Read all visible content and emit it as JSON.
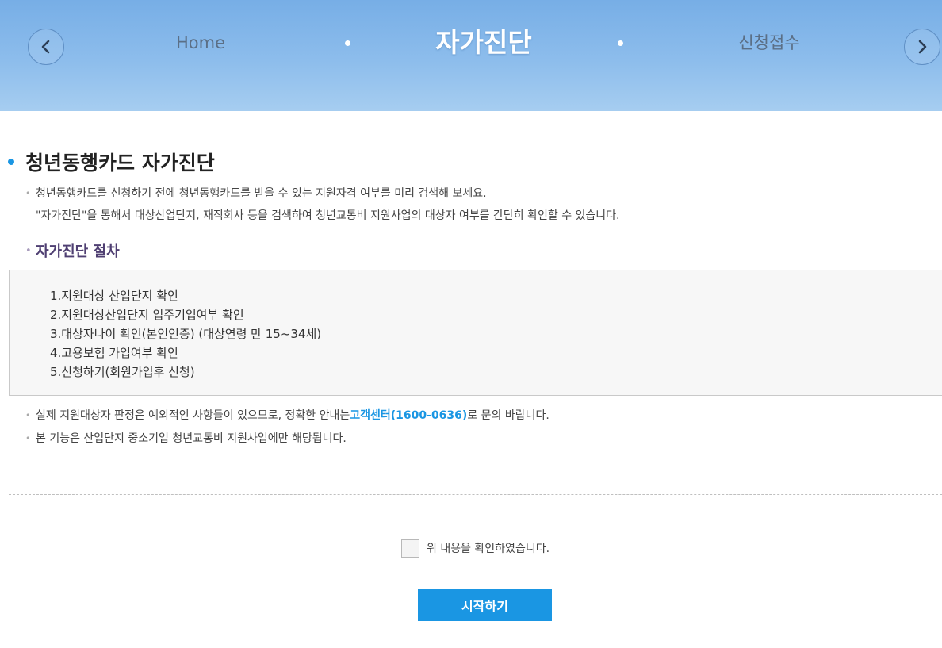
{
  "header": {
    "nav_prev_icon": "chevron-left-icon",
    "nav_next_icon": "chevron-right-icon",
    "home_label": "Home",
    "current_label": "자가진단",
    "apply_label": "신청접수",
    "banner_color": "#8dbdec"
  },
  "main": {
    "title": "청년동행카드 자가진단",
    "description": [
      "청년동행카드를 신청하기 전에 청년동행카드를 받을 수 있는 지원자격 여부를 미리 검색해 보세요.",
      "\"자가진단\"을 통해서 대상산업단지, 재직회사 등을 검색하여 청년교통비 지원사업의 대상자 여부를 간단히 확인할 수 있습니다."
    ],
    "procedure_title": "자가진단 절차",
    "steps": [
      "1.지원대상 산업단지 확인",
      "2.지원대상산업단지 입주기업여부 확인",
      "3.대상자나이 확인(본인인증) (대상연령 만 15~34세)",
      "4.고용보험 가입여부 확인",
      "5.신청하기(회원가입후 신청)"
    ],
    "notes": {
      "note1_prefix": "실제 지원대상자 판정은 예외적인 사항들이 있으므로, 정확한 안내는 ",
      "note1_link": "고객센터(1600-0636)",
      "note1_suffix": "로 문의 바랍니다.",
      "note2": "본 기능은 산업단지 중소기업 청년교통비 지원사업에만 해당됩니다."
    }
  },
  "footer": {
    "confirm_label": "위 내용을 확인하였습니다.",
    "confirm_checked": false,
    "start_button_label": "시작하기",
    "accent_color": "#1a96e3"
  }
}
